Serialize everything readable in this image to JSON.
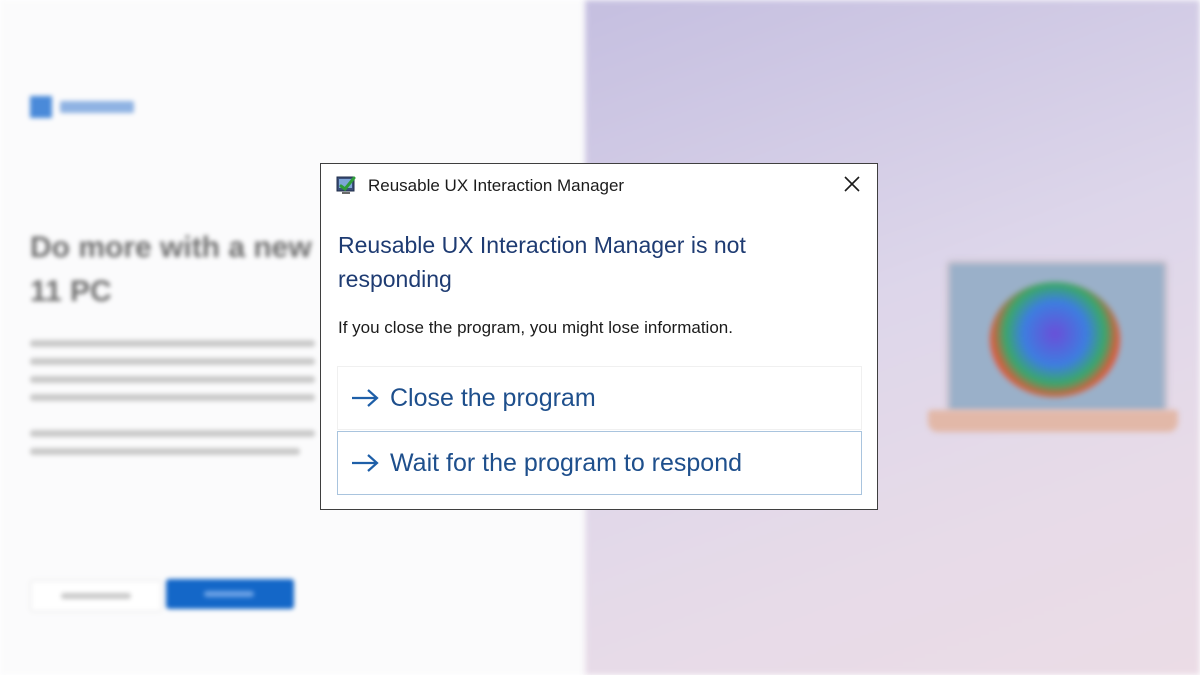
{
  "dialog": {
    "title": "Reusable UX Interaction Manager",
    "main_instruction": "Reusable UX Interaction Manager is not responding",
    "content": "If you close the program, you might lose information.",
    "commands": [
      {
        "label": "Close the program",
        "icon": "arrow-right-icon"
      },
      {
        "label": "Wait for the program to respond",
        "icon": "arrow-right-icon"
      }
    ],
    "close_icon": "close-icon",
    "app_icon": "app-icon"
  },
  "background": {
    "heading_lines": [
      "Do more with a new",
      "11 PC"
    ]
  },
  "colors": {
    "instruction_text": "#1e3b72",
    "link_text": "#1e4f8c",
    "link_border_focused": "#a9c4de",
    "dialog_border": "#3f3f3f",
    "bg_right_purple": "#d8d0e8"
  }
}
